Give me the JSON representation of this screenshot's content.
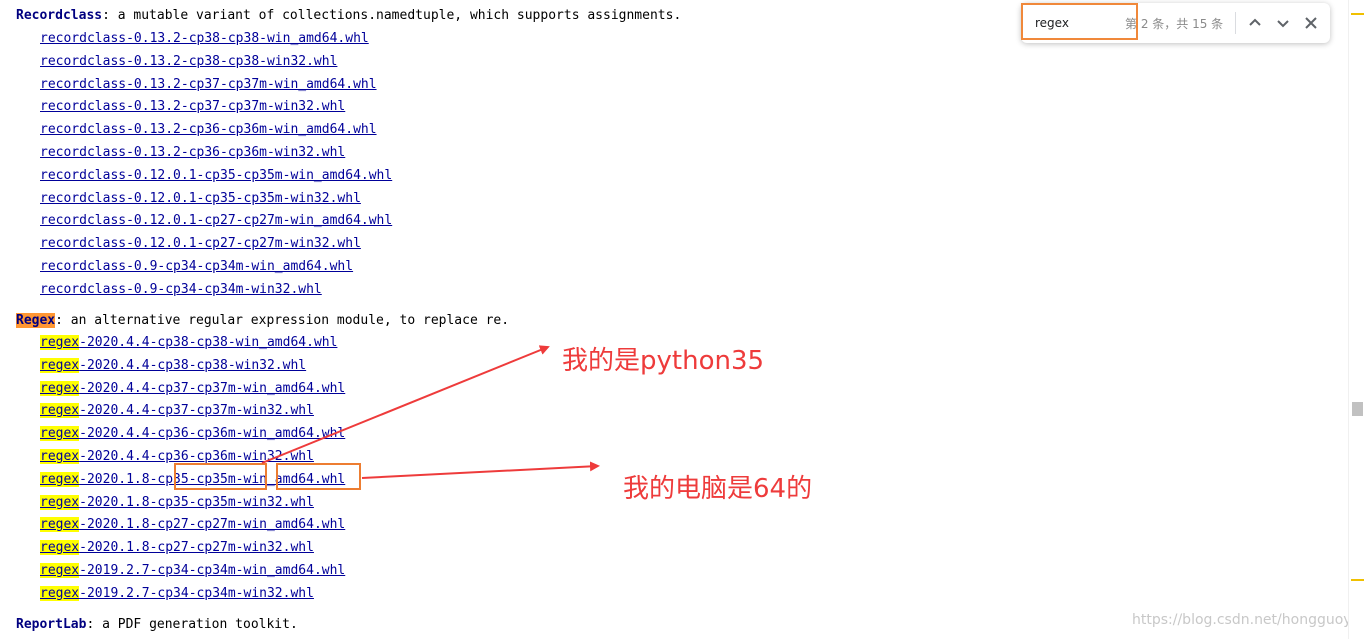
{
  "recordclass": {
    "name": "Recordclass",
    "description": ": a mutable variant of collections.namedtuple, which supports assignments.",
    "files": [
      "recordclass‑0.13.2‑cp38‑cp38‑win_amd64.whl",
      "recordclass‑0.13.2‑cp38‑cp38‑win32.whl",
      "recordclass‑0.13.2‑cp37‑cp37m‑win_amd64.whl",
      "recordclass‑0.13.2‑cp37‑cp37m‑win32.whl",
      "recordclass‑0.13.2‑cp36‑cp36m‑win_amd64.whl",
      "recordclass‑0.13.2‑cp36‑cp36m‑win32.whl",
      "recordclass‑0.12.0.1‑cp35‑cp35m‑win_amd64.whl",
      "recordclass‑0.12.0.1‑cp35‑cp35m‑win32.whl",
      "recordclass‑0.12.0.1‑cp27‑cp27m‑win_amd64.whl",
      "recordclass‑0.12.0.1‑cp27‑cp27m‑win32.whl",
      "recordclass‑0.9‑cp34‑cp34m‑win_amd64.whl",
      "recordclass‑0.9‑cp34‑cp34m‑win32.whl"
    ]
  },
  "regex": {
    "name": "Regex",
    "description": ": an alternative regular expression module, to replace re.",
    "match_prefix": "regex",
    "files": [
      "‑2020.4.4‑cp38‑cp38‑win_amd64.whl",
      "‑2020.4.4‑cp38‑cp38‑win32.whl",
      "‑2020.4.4‑cp37‑cp37m‑win_amd64.whl",
      "‑2020.4.4‑cp37‑cp37m‑win32.whl",
      "‑2020.4.4‑cp36‑cp36m‑win_amd64.whl",
      "‑2020.4.4‑cp36‑cp36m‑win32.whl",
      "‑2020.1.8‑cp35‑cp35m‑win_amd64.whl",
      "‑2020.1.8‑cp35‑cp35m‑win32.whl",
      "‑2020.1.8‑cp27‑cp27m‑win_amd64.whl",
      "‑2020.1.8‑cp27‑cp27m‑win32.whl",
      "‑2019.2.7‑cp34‑cp34m‑win_amd64.whl",
      "‑2019.2.7‑cp34‑cp34m‑win32.whl"
    ]
  },
  "reportlab": {
    "name": "ReportLab",
    "description": ": a PDF generation toolkit."
  },
  "find_bar": {
    "query": "regex",
    "match_count": "第 2 条，共 15 条",
    "prev_icon": "chevron-up-icon",
    "next_icon": "chevron-down-icon",
    "close_icon": "close-icon"
  },
  "annotations": {
    "python_version_note": "我的是python35",
    "arch_note": "我的电脑是64的"
  },
  "watermark": "https://blog.csdn.net/hongguoya",
  "colors": {
    "link": "#000099",
    "current_match": "#ff9632",
    "match": "#ffff00",
    "annotation_red": "#ee3b3b",
    "annotation_box": "#ed7d31"
  }
}
